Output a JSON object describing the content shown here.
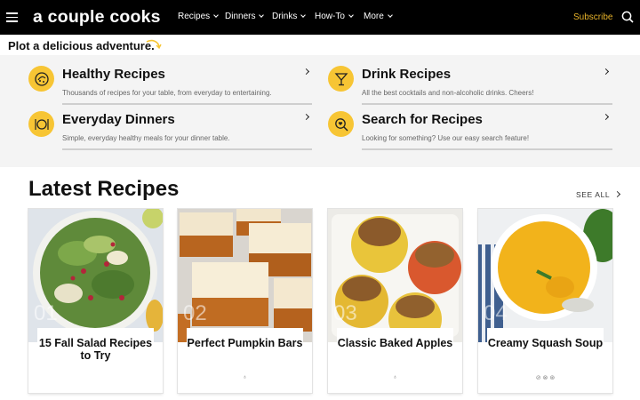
{
  "header": {
    "logo": "a couple cooks",
    "menu_icon": "hamburger-menu-icon",
    "nav": [
      {
        "label": "Recipes"
      },
      {
        "label": "Dinners"
      },
      {
        "label": "Drinks"
      },
      {
        "label": "How-To"
      },
      {
        "label": "More"
      }
    ],
    "subscribe": "Subscribe",
    "search_icon": "search-icon",
    "brand_accent": "#e8b32a"
  },
  "tagline": "Plot a delicious adventure.",
  "categories": [
    {
      "title": "Healthy Recipes",
      "desc": "Thousands of recipes for your table, from everyday to entertaining.",
      "icon": "salad-bowl-icon"
    },
    {
      "title": "Drink Recipes",
      "desc": "All the best cocktails and non-alcoholic drinks. Cheers!",
      "icon": "cocktail-glass-icon"
    },
    {
      "title": "Everyday Dinners",
      "desc": "Simple, everyday healthy meals for your dinner table.",
      "icon": "plate-cutlery-icon"
    },
    {
      "title": "Search for Recipes",
      "desc": "Looking for something? Use our easy search feature!",
      "icon": "magnifier-heart-icon"
    }
  ],
  "latest": {
    "heading": "Latest Recipes",
    "see_all": "SEE ALL",
    "cards": [
      {
        "num": "01",
        "title": "15 Fall Salad Recipes to Try",
        "diet_icons": ""
      },
      {
        "num": "02",
        "title": "Perfect Pumpkin Bars",
        "diet_icons": "♁"
      },
      {
        "num": "03",
        "title": "Classic Baked Apples",
        "diet_icons": "♁"
      },
      {
        "num": "04",
        "title": "Creamy Squash Soup",
        "diet_icons": "⊘ ⊗ ⊛"
      }
    ]
  },
  "colors": {
    "yellow": "#f7c534",
    "panel": "#f4f4f4"
  }
}
